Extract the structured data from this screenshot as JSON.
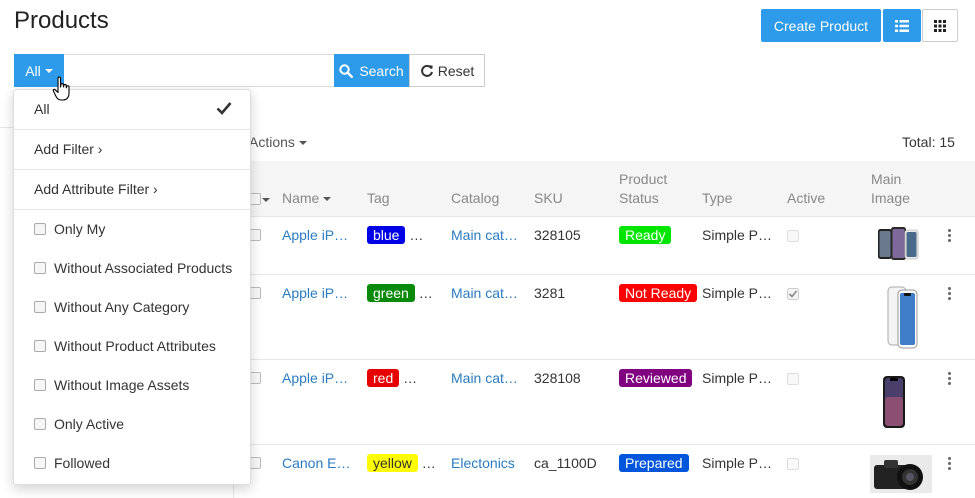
{
  "page": {
    "title": "Products"
  },
  "toolbar": {
    "create_label": "Create Product",
    "list_view_icon": "list-icon",
    "grid_view_icon": "grid-icon"
  },
  "search": {
    "filter_label": "All",
    "placeholder": "",
    "search_label": "Search",
    "reset_label": "Reset"
  },
  "dropdown": {
    "all_label": "All",
    "add_filter_label": "Add Filter ›",
    "add_attribute_filter_label": "Add Attribute Filter ›",
    "options": [
      "Only My",
      "Without Associated Products",
      "Without Any Category",
      "Without Product Attributes",
      "Without Image Assets",
      "Only Active",
      "Followed"
    ]
  },
  "list": {
    "actions_label": "Actions",
    "total_label": "Total: 15",
    "headers": {
      "name": "Name",
      "tag": "Tag",
      "catalog": "Catalog",
      "sku": "SKU",
      "status_line1": "Product",
      "status_line2": "Status",
      "type": "Type",
      "active": "Active",
      "image_line1": "Main",
      "image_line2": "Image"
    },
    "rows": [
      {
        "name": "Apple iP…",
        "tag": "blue",
        "tag_more": "…",
        "catalog": "Main cat…",
        "sku": "328105",
        "status": "Ready",
        "type": "Simple P…",
        "active": false
      },
      {
        "name": "Apple iP…",
        "tag": "green",
        "tag_more": "…",
        "catalog": "Main cat…",
        "sku": "3281",
        "status": "Not Ready",
        "type": "Simple P…",
        "active": true
      },
      {
        "name": "Apple iP…",
        "tag": "red",
        "tag_more": "…",
        "catalog": "Main cat…",
        "sku": "328108",
        "status": "Reviewed",
        "type": "Simple P…",
        "active": false
      },
      {
        "name": "Canon E…",
        "tag": "yellow",
        "tag_more": "…",
        "catalog": "Electonics",
        "sku": "ca_1100D",
        "status": "Prepared",
        "type": "Simple P…",
        "active": false
      }
    ]
  },
  "colors": {
    "primary": "#2d9bea",
    "tag_blue": "#0000e6",
    "tag_green": "#0a8a0a",
    "tag_red": "#e60000",
    "tag_yellow": "#ffff00",
    "status_ready": "#00e600",
    "status_not_ready": "#ff0000",
    "status_reviewed": "#800080",
    "status_prepared": "#0055dd"
  }
}
